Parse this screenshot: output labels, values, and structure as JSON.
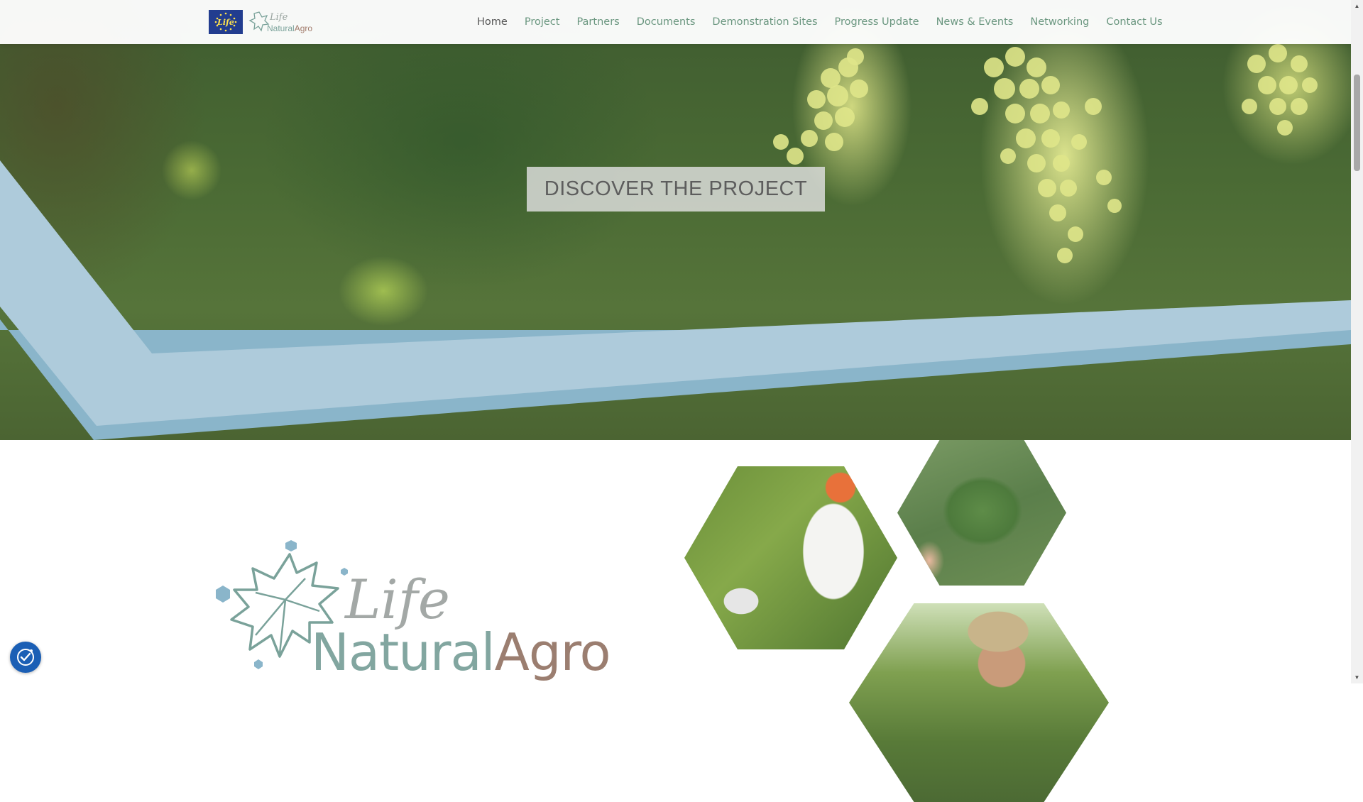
{
  "header": {
    "eu_badge_text": "Life",
    "logo": {
      "line1": "Life",
      "line2_a": "Natural",
      "line2_b": "Agro"
    },
    "nav": [
      {
        "label": "Home",
        "active": true
      },
      {
        "label": "Project"
      },
      {
        "label": "Partners"
      },
      {
        "label": "Documents"
      },
      {
        "label": "Demonstration Sites"
      },
      {
        "label": "Progress Update"
      },
      {
        "label": "News & Events"
      },
      {
        "label": "Networking"
      },
      {
        "label": "Contact Us"
      }
    ]
  },
  "hero": {
    "cta_label": "DISCOVER THE PROJECT"
  },
  "brand_logo": {
    "life": "Life",
    "natural": "Natural",
    "agro": "Agro"
  },
  "colors": {
    "ribbon_light": "#aecbdb",
    "ribbon_dark": "#8ab5ca",
    "nav_text": "#6b9780",
    "nav_active": "#555555",
    "logo_natural": "#82a6a0",
    "logo_agro": "#9b7e70",
    "cookie_button": "#1b5fb5"
  },
  "icons": {
    "cookie_settings": "cookie-consent-icon",
    "scroll_up": "scroll-up-arrow-icon",
    "scroll_down": "scroll-down-arrow-icon"
  }
}
